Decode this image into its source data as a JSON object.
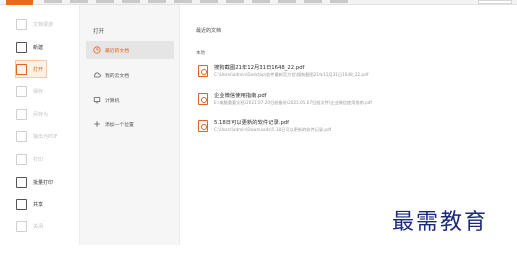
{
  "nav": {
    "items": [
      {
        "label": "文档漫游",
        "state": "dim"
      },
      {
        "label": "新建",
        "state": "normal"
      },
      {
        "label": "打开",
        "state": "active"
      },
      {
        "label": "保存",
        "state": "dim"
      },
      {
        "label": "另存为",
        "state": "dim"
      },
      {
        "label": "输出为PDF",
        "state": "dim"
      },
      {
        "label": "打印",
        "state": "dim"
      },
      {
        "label": "批量打印",
        "state": "normal"
      },
      {
        "label": "共享",
        "state": "normal"
      },
      {
        "label": "关闭",
        "state": "dim"
      }
    ]
  },
  "open_panel": {
    "title": "打开",
    "items": [
      {
        "label": "最近的文档",
        "icon": "clock-icon",
        "active": true
      },
      {
        "label": "我的云文档",
        "icon": "cloud-icon",
        "active": false
      },
      {
        "label": "计算机",
        "icon": "computer-icon",
        "active": false
      },
      {
        "label": "添加一个位置",
        "icon": "add-location-icon",
        "active": false
      }
    ]
  },
  "recent": {
    "title": "最近的文档",
    "section_label": "本地",
    "files": [
      {
        "name": "搜狗截图21年12月31日1648_22.pdf",
        "path": "C:\\Users\\admin\\Desktop\\软件最新官方包\\搜狗截图21年12月31日1648_22.pdf"
      },
      {
        "name": "企业微信使用指南.pdf",
        "path": "E:\\电脑重要文档\\2021.07.20归档备份\\2021.05.07归档文件\\企业微信使用指南.pdf"
      },
      {
        "name": "5.18日可以更新的软件记录.pdf",
        "path": "C:\\Users\\admin\\Downloads\\5.18日可以更新的软件记录.pdf"
      }
    ]
  },
  "watermark": "最需教育",
  "colors": {
    "accent": "#e3631f",
    "pdf_icon": "#e0612a",
    "watermark": "#1b2a7a"
  }
}
